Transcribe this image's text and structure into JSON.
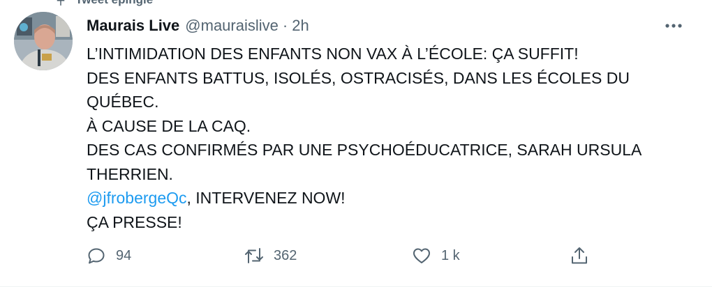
{
  "pinned_label": "Tweet épinglé",
  "author": {
    "name": "Maurais Live",
    "handle": "@mauraislive",
    "separator": "·",
    "time": "2h"
  },
  "text": {
    "line1": "L’INTIMIDATION DES ENFANTS NON VAX À L’ÉCOLE: ÇA SUFFIT!",
    "line2": "DES ENFANTS BATTUS, ISOLÉS, OSTRACISÉS, DANS LES ÉCOLES DU",
    "line3": "QUÉBEC.",
    "line4": "À CAUSE DE LA CAQ.",
    "line5": "DES CAS CONFIRMÉS PAR UNE PSYCHOÉDUCATRICE, SARAH URSULA",
    "line6": "THERRIEN.",
    "mention": "@jfrobergeQc",
    "line7_rest": ", INTERVENEZ NOW!",
    "line8": "ÇA PRESSE!"
  },
  "actions": {
    "reply_count": "94",
    "retweet_count": "362",
    "like_count": "1 k"
  },
  "icons": {
    "pinned": "pin-icon",
    "more": "more-icon",
    "reply": "reply-icon",
    "retweet": "retweet-icon",
    "like": "heart-icon",
    "share": "share-icon"
  },
  "colors": {
    "link": "#1d9bf0",
    "secondary": "#536471",
    "text": "#0f1419"
  }
}
